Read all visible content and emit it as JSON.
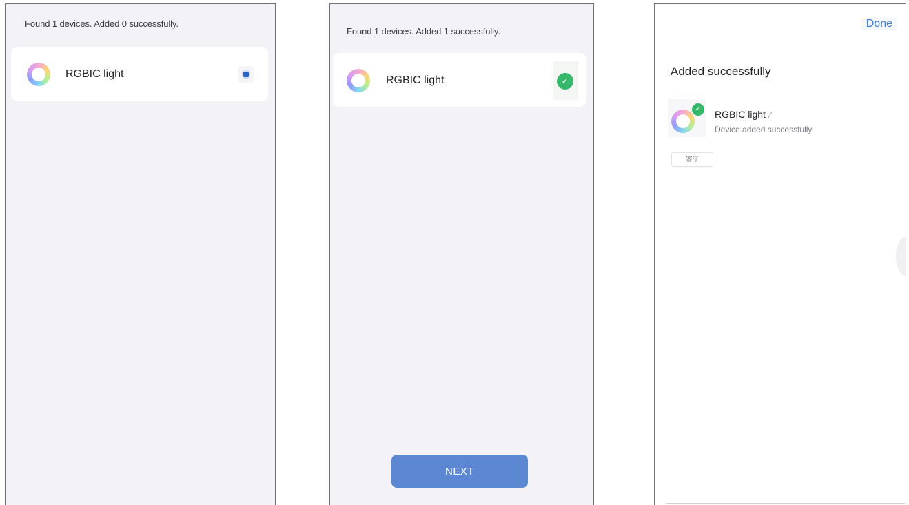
{
  "screens": {
    "searching": {
      "status_text": "Found 1 devices. Added 0 successfully.",
      "device": {
        "name": "RGBIC light",
        "icon": "rgbic-ring-icon",
        "state_icon": "loading-spinner-icon"
      }
    },
    "added": {
      "status_text": "Found 1 devices. Added 1 successfully.",
      "device": {
        "name": "RGBIC light",
        "icon": "rgbic-ring-icon",
        "state_icon": "check-circle-icon"
      },
      "next_label": "NEXT"
    },
    "success": {
      "done_label": "Done",
      "title": "Added successfully",
      "device_name": "RGBIC light",
      "device_status": "Device added successfully",
      "room_tag": "客厅"
    }
  },
  "colors": {
    "accent_blue": "#5c87d2",
    "link_blue": "#3d7fd6",
    "success_green": "#35b86a",
    "screen_background": "#f2f2f7"
  }
}
